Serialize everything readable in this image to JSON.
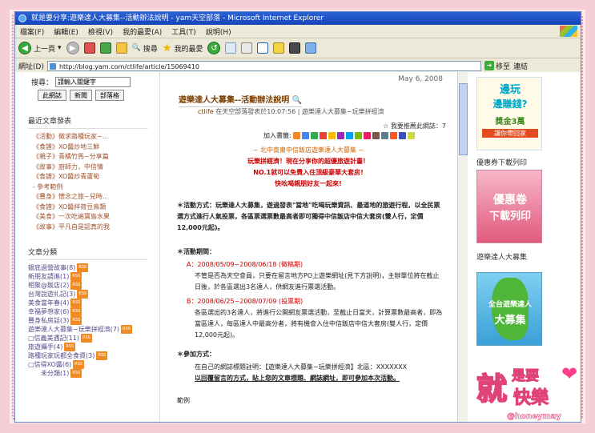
{
  "window": {
    "title": "就是要分享:遊樂達人大募集--活動辦法說明 - yam天空部落 - Microsoft Internet Explorer"
  },
  "menu": [
    "檔案(F)",
    "編輯(E)",
    "檢視(V)",
    "我的最愛(A)",
    "工具(T)",
    "說明(H)"
  ],
  "toolbar": {
    "back": "上一頁",
    "search": "搜尋",
    "favorites": "我的最愛"
  },
  "address": {
    "label": "網址(D)",
    "url": "http://blog.yam.com/ctlife/article/15069410",
    "go": "移至",
    "links": "連結"
  },
  "sidebar": {
    "search_label": "搜尋：",
    "search_placeholder": "請輸入關鍵字",
    "buttons": [
      "此網誌",
      "新聞",
      "部落格"
    ],
    "latest_title": "最近文章發表",
    "latest": [
      "《活動》徵求路種玩家~...",
      "《食譜》XO醬炒地三鮮",
      "《親子》青橘竹馬~分享篇",
      "《故事》廚師力，中信情",
      "《食譜》XO醬炒青蘆筍",
      "- 參考範例",
      "《豐身》懷念之旅~兒時...",
      "《食譜》XO醬拌荷豆鳥類",
      "《美食》一次吃遍寶島水果",
      "《故事》平凡自是認真的我"
    ],
    "category_title": "文章分類",
    "categories": [
      "銀底過營故事(8)",
      "新朋友請進(1)",
      "相聚@飯店(2)",
      "台灣說遊扎記(3)",
      "美食當年春(4)",
      "幸福夢想家(6)",
      "豐身私房話(3)",
      "遊樂達人大募集~玩樂拼經濟(7)",
      "▢信義美遇記(11)",
      "旅遊攝手(4)",
      "路種玩家玩都全食資(3)",
      "▢信得XO醬(6)",
      "未分類(1)"
    ]
  },
  "post": {
    "date": "May 6, 2008",
    "title": "遊樂達人大募集--活動辦法說明",
    "author": "ctlife",
    "meta": "在天空部落發表於10:07:56 | 遊樂達人大募集~玩樂拼經濟",
    "recommend": "☆ 我要推薦此網誌：7",
    "share_label": "加入書籤:",
    "promo": [
      "~ 北中南東中信飯店遊樂達人大募集 ~",
      "玩樂拼經濟！現在分享你的超優旅遊計畫！",
      "NO.1就可以免費入住頂級豪華大套房!",
      "快吆喝親朋好友一起來!"
    ],
    "p1": "＊活動方式：玩樂達人大募集，遊過發表\"當地\"吃喝玩樂資訊、最道地的旅遊行程，以全民票選方式進行人氣投票，各區票選票數最高者即可獨得中信飯店中信大套房(雙人行，定價12,000元起)。",
    "period_title": "＊活動期間：",
    "periodA_label": "A：2008/05/09~2008/06/18 (徵稿期)",
    "periodA_text": "不管是否為天空會員，只要在留言地方PO上遊樂網址(見下方說明)，主辦單位將在截止日後，於各區選出3名達人，供網友進行票選活動。",
    "periodB_label": "B：2008/06/25~2008/07/09 (投票期)",
    "periodB_text": "各區選出的3名達人，將進行公開網友票選活動，至截止日當天，計算票數最高者，即為當區達人，每區達人中最高分者，將有機會入住中信飯店中信大套房(雙人行，定價12,000元起)。",
    "join_title": "＊參加方式：",
    "join_text1": "在自己的網誌標題註明：【遊樂達人大募集~玩樂拼經濟】北區：XXXXXXX",
    "join_text2": "以回覆留言的方式，貼上您的文章標題、網誌網址，即可參加本次活動。",
    "footer": "範例"
  },
  "right": {
    "ad1": {
      "line1": "邊玩",
      "line2": "邊賺錢?",
      "line3": "獎金3萬",
      "line4": "讓你帶回家"
    },
    "coupon_title": "優惠券下載列印",
    "ad2": {
      "line1": "優惠卷",
      "line2": "下載列印"
    },
    "contest_title": "遊樂達人大募集",
    "ad3": {
      "line1": "全台遊樂達人",
      "line2": "大募集"
    }
  },
  "logo": {
    "text1": "就",
    "text2": "是要",
    "text3": "快樂",
    "handle": "@honeymay"
  },
  "colors": {
    "frame": "#f6cfd6",
    "accent": "#c00000",
    "title_bar": "#1546b8"
  }
}
